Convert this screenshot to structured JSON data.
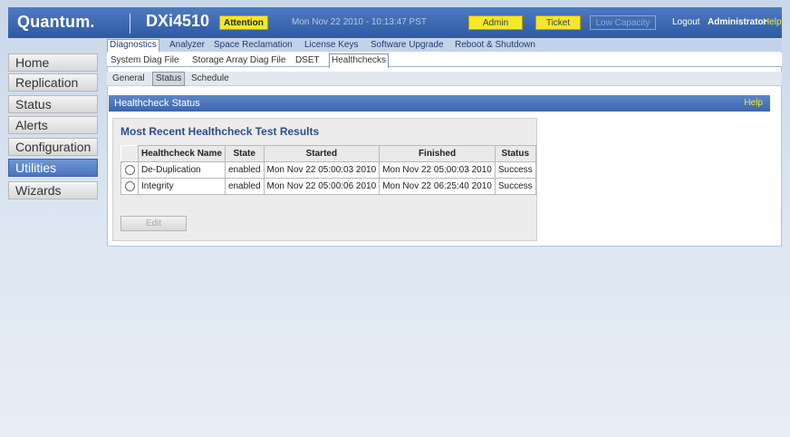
{
  "header": {
    "logo": "Quantum.",
    "product": "DXi4510",
    "attention": "Attention",
    "datetime": "Mon Nov 22 2010 - 10:13:47 PST",
    "admin": "Admin",
    "ticket": "Ticket",
    "low_capacity": "Low Capacity",
    "logout": "Logout",
    "user": "Administrator",
    "help": "Help"
  },
  "nav": {
    "items": [
      "Home",
      "Replication",
      "Status",
      "Alerts",
      "Configuration",
      "Utilities",
      "Wizards"
    ],
    "active": "Utilities"
  },
  "tabs_level1": [
    "Diagnostics",
    "Analyzer",
    "Space Reclamation",
    "License Keys",
    "Software Upgrade",
    "Reboot & Shutdown"
  ],
  "tabs_level2": [
    "System Diag File",
    "Storage Array Diag File",
    "DSET",
    "Healthchecks"
  ],
  "tabs_level3": [
    "General",
    "Status",
    "Schedule"
  ],
  "section": {
    "title": "Healthcheck Status",
    "help": "Help"
  },
  "results": {
    "title": "Most Recent Healthcheck Test Results",
    "columns": [
      "Healthcheck Name",
      "State",
      "Started",
      "Finished",
      "Status"
    ],
    "rows": [
      [
        "De-Duplication",
        "enabled",
        "Mon Nov 22 05:00:03 2010",
        "Mon Nov 22 05:00:03 2010",
        "Success"
      ],
      [
        "Integrity",
        "enabled",
        "Mon Nov 22 05:00:06 2010",
        "Mon Nov 22 06:25:40 2010",
        "Success"
      ]
    ],
    "edit_label": "Edit"
  }
}
